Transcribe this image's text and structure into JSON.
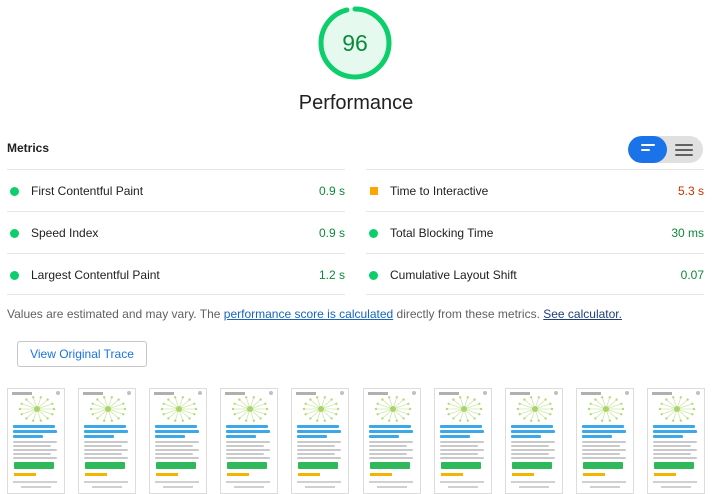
{
  "score": {
    "value": "96",
    "title": "Performance",
    "percent": 96,
    "color": "#0cce6b"
  },
  "metrics": {
    "header": "Metrics",
    "left": [
      {
        "label": "First Contentful Paint",
        "value": "0.9 s",
        "rating": "pass"
      },
      {
        "label": "Speed Index",
        "value": "0.9 s",
        "rating": "pass"
      },
      {
        "label": "Largest Contentful Paint",
        "value": "1.2 s",
        "rating": "pass"
      }
    ],
    "right": [
      {
        "label": "Time to Interactive",
        "value": "5.3 s",
        "rating": "average"
      },
      {
        "label": "Total Blocking Time",
        "value": "30 ms",
        "rating": "pass"
      },
      {
        "label": "Cumulative Layout Shift",
        "value": "0.07",
        "rating": "pass"
      }
    ]
  },
  "note": {
    "prefix": "Values are estimated and may vary. The ",
    "link1": "performance score is calculated",
    "middle": " directly from these metrics. ",
    "link2": "See calculator."
  },
  "trace_button": "View Original Trace",
  "filmstrip": {
    "frame_count": 10
  },
  "colors": {
    "pass": "#0cce6b",
    "average": "#ffa400",
    "accent": "#1a73e8"
  }
}
